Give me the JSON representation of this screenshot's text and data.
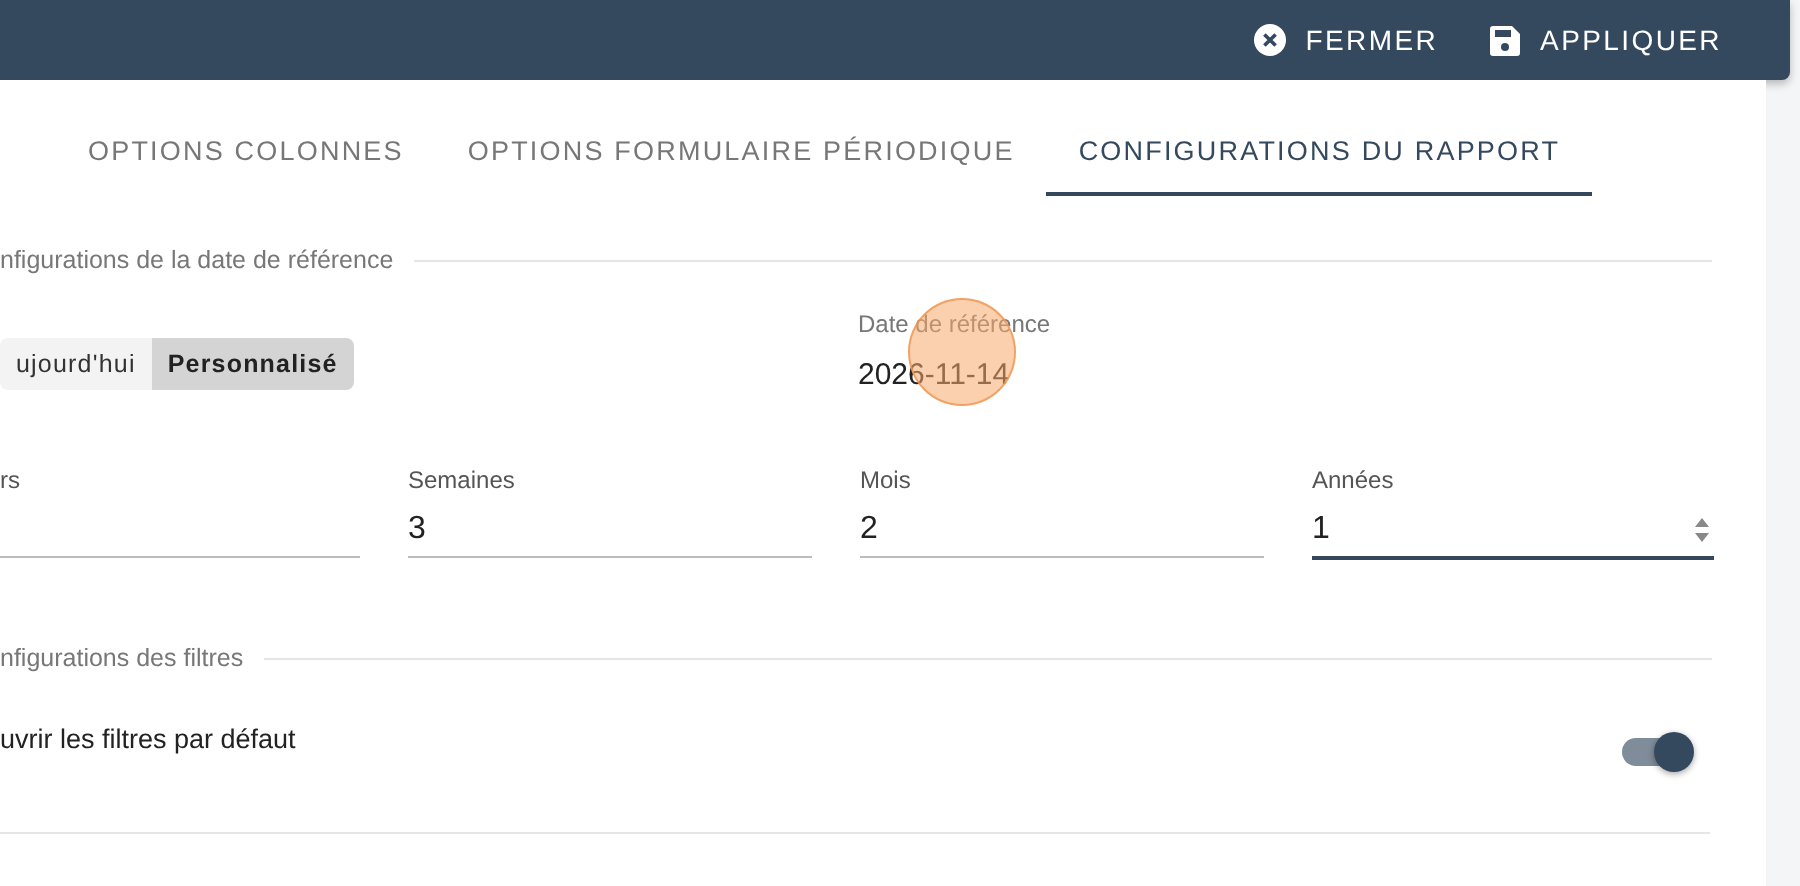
{
  "toolbar": {
    "buttons": [
      {
        "kind": "close",
        "label": "FERMER"
      },
      {
        "kind": "save",
        "label": "APPLIQUER"
      }
    ]
  },
  "tabs": [
    {
      "label": "OPTIONS COLONNES",
      "selected": false
    },
    {
      "label": "OPTIONS FORMULAIRE PÉRIODIQUE",
      "selected": false
    },
    {
      "label": "CONFIGURATIONS DU RAPPORT",
      "selected": true
    }
  ],
  "date_section": {
    "title": "nfigurations de la date de référence",
    "mode": [
      {
        "label": "ujourd'hui",
        "selected": false
      },
      {
        "label": "Personnalisé",
        "selected": true
      }
    ],
    "reference_date": {
      "label": "Date de référence",
      "value": "2026-11-14"
    },
    "fields": [
      {
        "label": "rs",
        "focused": false,
        "spinner": false
      },
      {
        "label": "Semaines",
        "value": "3",
        "focused": false,
        "spinner": false
      },
      {
        "label": "Mois",
        "value": "2",
        "focused": false,
        "spinner": false
      },
      {
        "label": "Années",
        "value": "1",
        "focused": true,
        "spinner": true
      }
    ]
  },
  "filter_section": {
    "title": "nfigurations des filtres",
    "options": [
      {
        "label": "uvrir les filtres par défaut",
        "on": true
      }
    ]
  }
}
